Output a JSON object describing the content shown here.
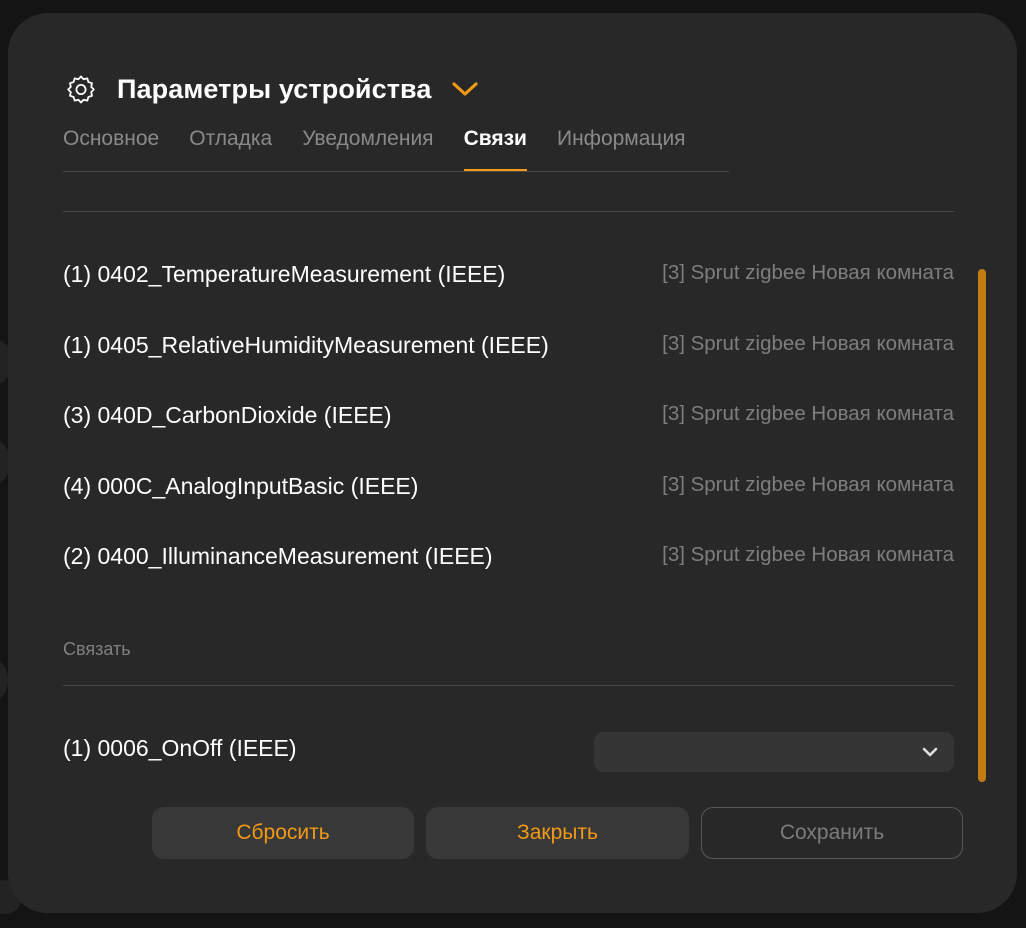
{
  "modal": {
    "title": "Параметры устройства",
    "tabs": [
      {
        "label": "Основное",
        "active": false
      },
      {
        "label": "Отладка",
        "active": false
      },
      {
        "label": "Уведомления",
        "active": false
      },
      {
        "label": "Связи",
        "active": true
      },
      {
        "label": "Информация",
        "active": false
      }
    ],
    "links": [
      {
        "name": "(1) 0402_TemperatureMeasurement (IEEE)",
        "target": "[3] Sprut zigbee Новая комната"
      },
      {
        "name": "(1) 0405_RelativeHumidityMeasurement (IEEE)",
        "target": "[3] Sprut zigbee Новая комната"
      },
      {
        "name": "(3) 040D_CarbonDioxide (IEEE)",
        "target": "[3] Sprut zigbee Новая комната"
      },
      {
        "name": "(4) 000C_AnalogInputBasic (IEEE)",
        "target": "[3] Sprut zigbee Новая комната"
      },
      {
        "name": "(2) 0400_IlluminanceMeasurement (IEEE)",
        "target": "[3] Sprut zigbee Новая комната"
      }
    ],
    "bind_section": {
      "label": "Связать",
      "row_name": "(1) 0006_OnOff (IEEE)",
      "select_value": ""
    },
    "buttons": {
      "reset": "Сбросить",
      "close": "Закрыть",
      "save": "Сохранить"
    }
  },
  "colors": {
    "accent": "#f29a13",
    "modal_bg": "#282828",
    "scrollbar": "#c27c14"
  },
  "icons": {
    "header": "gear-icon",
    "title_toggle": "chevron-down-icon",
    "select": "chevron-down-icon"
  }
}
